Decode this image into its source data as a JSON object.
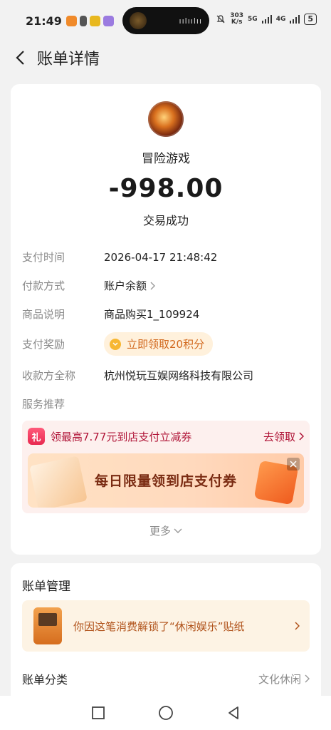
{
  "status_bar": {
    "time": "21:49",
    "net_speed": "303",
    "net_speed_unit": "K/s",
    "signal1": "5G",
    "signal2": "4G",
    "battery": "5"
  },
  "header": {
    "title": "账单详情"
  },
  "transaction": {
    "merchant": "冒险游戏",
    "amount": "-998.00",
    "status": "交易成功"
  },
  "details": [
    {
      "label": "支付时间",
      "value": "2026-04-17 21:48:42"
    },
    {
      "label": "付款方式",
      "value": "账户余额"
    },
    {
      "label": "商品说明",
      "value": "商品购买1_109924"
    },
    {
      "label": "支付奖励",
      "value": "立即领取20积分"
    },
    {
      "label": "收款方全称",
      "value": "杭州悦玩互娱网络科技有限公司"
    },
    {
      "label": "服务推荐",
      "value": ""
    }
  ],
  "promo": {
    "gift_glyph": "礼",
    "title": "领最高7.77元到店支付立减券",
    "action": "去领取",
    "banner_text": "每日限量领到店支付券"
  },
  "more_label": "更多",
  "manage": {
    "title": "账单管理",
    "sticker_text": "你因这笔消费解锁了“休闲娱乐”贴纸",
    "category_label": "账单分类",
    "category_value": "文化休闲"
  },
  "colors": {
    "accent_red": "#b01437",
    "reward_orange": "#d2691e",
    "sticker_brown": "#b0521a"
  }
}
